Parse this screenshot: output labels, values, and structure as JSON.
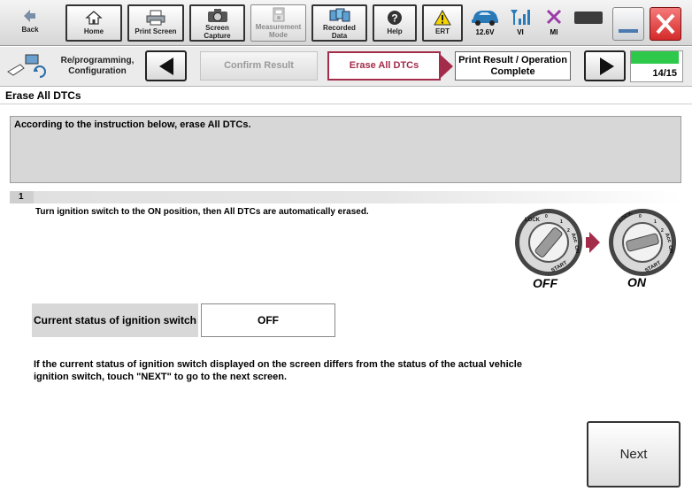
{
  "toolbar": {
    "back": {
      "label": "Back",
      "icon": "back-arrow-icon"
    },
    "home": {
      "label": "Home",
      "icon": "home-icon"
    },
    "print_screen": {
      "label": "Print Screen",
      "icon": "printer-icon"
    },
    "screen_capture": {
      "label": "Screen Capture",
      "icon": "camera-icon"
    },
    "measurement_mode": {
      "label": "Measurement Mode",
      "icon": "meter-icon"
    },
    "recorded_data": {
      "label": "Recorded Data",
      "icon": "recorded-data-icon"
    },
    "help": {
      "label": "Help",
      "icon": "help-icon"
    },
    "ert": {
      "label": "ERT",
      "icon": "warning-icon"
    },
    "battery": {
      "label": "12.6V",
      "icon": "car-icon"
    },
    "vi": {
      "label": "VI",
      "icon": "signal-icon"
    },
    "mi": {
      "label": "MI",
      "icon": "x-mark-icon"
    }
  },
  "stepbar": {
    "category": "Re/programming, Configuration",
    "steps": [
      {
        "label": "Confirm Result",
        "state": "done"
      },
      {
        "label": "Erase All DTCs",
        "state": "current"
      },
      {
        "label": "Print Result / Operation Complete",
        "state": "next"
      }
    ],
    "progress": {
      "text": "14/15",
      "value": 0.93
    }
  },
  "page": {
    "title": "Erase All DTCs",
    "instruction": "According to the instruction below, erase All DTCs.",
    "step_number": "1",
    "step_text": "Turn ignition switch to the ON position, then All DTCs are automatically erased.",
    "ignition_graphic": {
      "dial_text": [
        "LOCK",
        "0",
        "1",
        "2",
        "Acc",
        "ON",
        "START"
      ],
      "off_caption": "OFF",
      "on_caption": "ON"
    },
    "status_label": "Current status of ignition switch",
    "status_value": "OFF",
    "note": "If the current status of ignition switch displayed on the screen differs from the status of the actual vehicle ignition switch, touch \"NEXT\" to go to the next screen.",
    "next_label": "Next"
  },
  "colors": {
    "accent": "#a32c4a",
    "progress": "#2ec84a",
    "close": "#e03a3a"
  }
}
